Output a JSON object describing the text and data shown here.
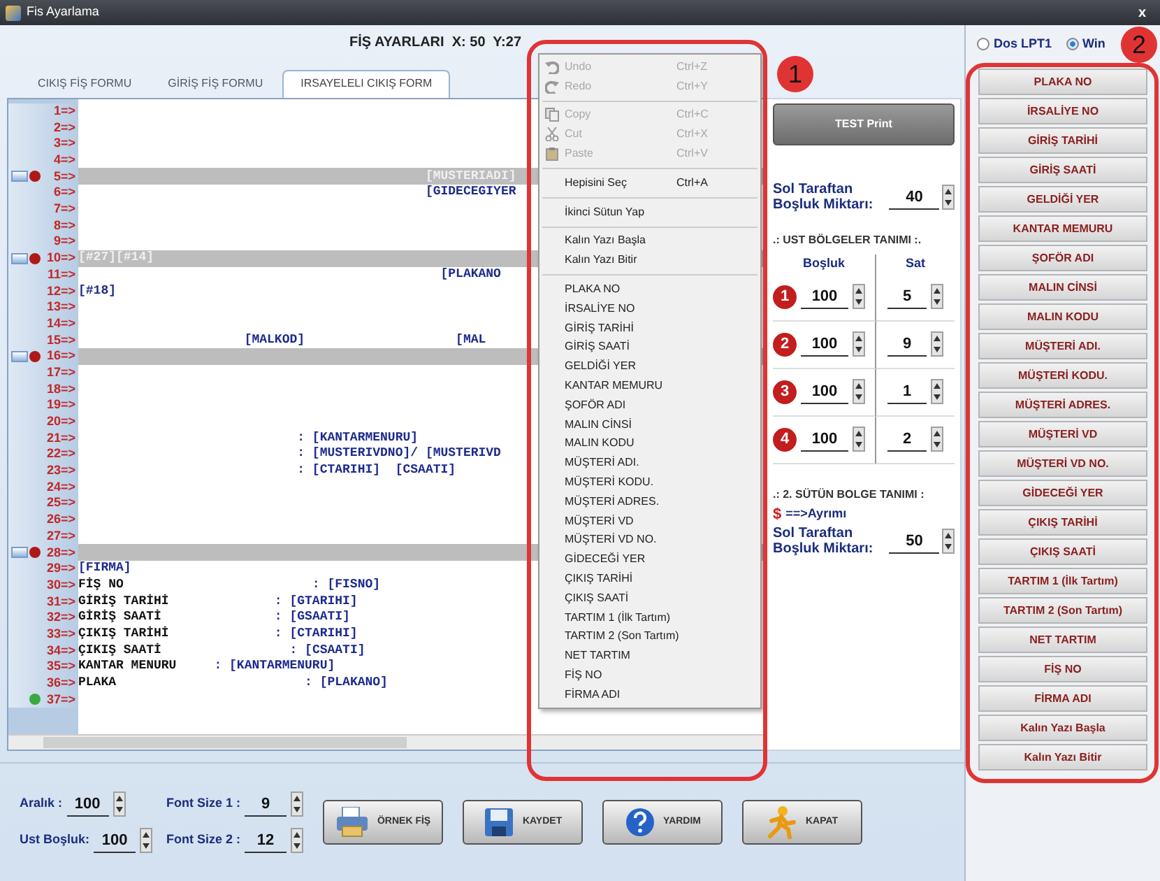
{
  "window": {
    "title": "Fis Ayarlama",
    "close": "x"
  },
  "header": "FİŞ AYARLARI  X: 50  Y:27",
  "tabs": [
    {
      "label": "CIKIŞ FİŞ FORMU",
      "selected": false
    },
    {
      "label": "GİRİŞ FİŞ FORMU",
      "selected": false
    },
    {
      "label": "IRSAYELELI CIKIŞ FORM",
      "selected": true
    }
  ],
  "editor": {
    "lines": [
      {
        "label": "1=>",
        "kind": "plain"
      },
      {
        "label": "2=>",
        "kind": "plain"
      },
      {
        "label": "3=>",
        "kind": "plain"
      },
      {
        "label": "4=>",
        "kind": "plain"
      },
      {
        "label": "5=>",
        "kind": "band",
        "segments": [
          {
            "kind": "field",
            "text": "                                              [MUSTERIADI]"
          }
        ]
      },
      {
        "label": "6=>",
        "kind": "plain",
        "segments": [
          {
            "kind": "field",
            "text": "                                              [GIDECEGIYER"
          }
        ]
      },
      {
        "label": "7=>",
        "kind": "plain"
      },
      {
        "label": "8=>",
        "kind": "plain"
      },
      {
        "label": "9=>",
        "kind": "plain"
      },
      {
        "label": "10=>",
        "kind": "band",
        "segments": [
          {
            "kind": "field",
            "text": "[#27][#14]"
          }
        ]
      },
      {
        "label": "11=>",
        "kind": "plain",
        "segments": [
          {
            "kind": "field",
            "text": "                                                [PLAKANO"
          }
        ]
      },
      {
        "label": "12=>",
        "kind": "plain",
        "segments": [
          {
            "kind": "field",
            "text": "[#18]"
          }
        ]
      },
      {
        "label": "13=>",
        "kind": "plain"
      },
      {
        "label": "14=>",
        "kind": "plain"
      },
      {
        "label": "15=>",
        "kind": "plain",
        "segments": [
          {
            "kind": "field",
            "text": "                      [MALKOD]                    [MAL"
          }
        ]
      },
      {
        "label": "16=>",
        "kind": "band"
      },
      {
        "label": "17=>",
        "kind": "plain"
      },
      {
        "label": "18=>",
        "kind": "plain"
      },
      {
        "label": "19=>",
        "kind": "plain"
      },
      {
        "label": "20=>",
        "kind": "plain"
      },
      {
        "label": "21=>",
        "kind": "plain",
        "segments": [
          {
            "kind": "field",
            "text": "                             : [KANTARMENURU]"
          }
        ]
      },
      {
        "label": "22=>",
        "kind": "plain",
        "segments": [
          {
            "kind": "field",
            "text": "                             : [MUSTERIVDNO]/ [MUSTERIVD"
          }
        ]
      },
      {
        "label": "23=>",
        "kind": "plain",
        "segments": [
          {
            "kind": "field",
            "text": "                             : [CTARIHI]  [CSAATI]"
          }
        ]
      },
      {
        "label": "24=>",
        "kind": "plain"
      },
      {
        "label": "25=>",
        "kind": "plain"
      },
      {
        "label": "26=>",
        "kind": "plain"
      },
      {
        "label": "27=>",
        "kind": "plain"
      },
      {
        "label": "28=>",
        "kind": "band"
      },
      {
        "label": "29=>",
        "kind": "plain",
        "segments": [
          {
            "kind": "field",
            "text": "[FIRMA]"
          }
        ]
      },
      {
        "label": "30=>",
        "kind": "plain",
        "segments": [
          {
            "kind": "label",
            "text": "FİŞ NO"
          },
          {
            "kind": "field",
            "text": "                         : [FISNO]"
          }
        ]
      },
      {
        "label": "31=>",
        "kind": "plain",
        "segments": [
          {
            "kind": "label",
            "text": "GİRİŞ TARİHİ"
          },
          {
            "kind": "field",
            "text": "              : [GTARIHI]"
          }
        ]
      },
      {
        "label": "32=>",
        "kind": "plain",
        "segments": [
          {
            "kind": "label",
            "text": "GİRİŞ SAATİ"
          },
          {
            "kind": "field",
            "text": "               : [GSAATI]"
          }
        ]
      },
      {
        "label": "33=>",
        "kind": "plain",
        "segments": [
          {
            "kind": "label",
            "text": "ÇIKIŞ TARİHİ"
          },
          {
            "kind": "field",
            "text": "              : [CTARIHI]"
          }
        ]
      },
      {
        "label": "34=>",
        "kind": "plain",
        "segments": [
          {
            "kind": "label",
            "text": "ÇIKIŞ SAATİ"
          },
          {
            "kind": "field",
            "text": "                 : [CSAATI]"
          }
        ]
      },
      {
        "label": "35=>",
        "kind": "plain",
        "segments": [
          {
            "kind": "label",
            "text": "KANTAR MENURU"
          },
          {
            "kind": "field",
            "text": "     : [KANTARMENURU]"
          }
        ]
      },
      {
        "label": "36=>",
        "kind": "plain",
        "segments": [
          {
            "kind": "label",
            "text": "PLAKA"
          },
          {
            "kind": "field",
            "text": "                         : [PLAKANO]"
          }
        ]
      },
      {
        "label": "37=>",
        "kind": "end"
      }
    ]
  },
  "context_menu": [
    {
      "kind": "item",
      "text": "Undo",
      "shortcut": "Ctrl+Z",
      "disabled": true
    },
    {
      "kind": "item",
      "text": "Redo",
      "shortcut": "Ctrl+Y",
      "disabled": true
    },
    {
      "kind": "separator"
    },
    {
      "kind": "item",
      "text": "Copy",
      "shortcut": "Ctrl+C",
      "disabled": true
    },
    {
      "kind": "item",
      "text": "Cut",
      "shortcut": "Ctrl+X",
      "disabled": true
    },
    {
      "kind": "item",
      "text": "Paste",
      "shortcut": "Ctrl+V",
      "disabled": true
    },
    {
      "kind": "separator"
    },
    {
      "kind": "item",
      "text": "Hepisini Seç",
      "shortcut": "Ctrl+A",
      "disabled": false
    },
    {
      "kind": "separator"
    },
    {
      "kind": "item",
      "text": "İkinci Sütun Yap",
      "disabled": false
    },
    {
      "kind": "separator"
    },
    {
      "kind": "item",
      "text": "Kalın Yazı Başla",
      "disabled": false
    },
    {
      "kind": "item",
      "text": "Kalın Yazı Bitir",
      "disabled": false
    },
    {
      "kind": "separator"
    },
    {
      "kind": "item",
      "text": "PLAKA NO",
      "disabled": false
    },
    {
      "kind": "item",
      "text": "İRSALİYE NO",
      "disabled": false
    },
    {
      "kind": "item",
      "text": "GİRİŞ TARİHİ",
      "disabled": false
    },
    {
      "kind": "item",
      "text": "GİRİŞ SAATİ",
      "disabled": false
    },
    {
      "kind": "item",
      "text": "GELDİĞİ YER",
      "disabled": false
    },
    {
      "kind": "item",
      "text": "KANTAR MEMURU",
      "disabled": false
    },
    {
      "kind": "item",
      "text": "ŞOFÖR ADI",
      "disabled": false
    },
    {
      "kind": "item",
      "text": "MALIN CİNSİ",
      "disabled": false
    },
    {
      "kind": "item",
      "text": "MALIN KODU",
      "disabled": false
    },
    {
      "kind": "item",
      "text": "MÜŞTERİ ADI.",
      "disabled": false
    },
    {
      "kind": "item",
      "text": "MÜŞTERİ KODU.",
      "disabled": false
    },
    {
      "kind": "item",
      "text": "MÜŞTERİ ADRES.",
      "disabled": false
    },
    {
      "kind": "item",
      "text": "MÜŞTERİ VD",
      "disabled": false
    },
    {
      "kind": "item",
      "text": "MÜŞTERİ VD NO.",
      "disabled": false
    },
    {
      "kind": "item",
      "text": "GİDECEĞİ YER",
      "disabled": false
    },
    {
      "kind": "item",
      "text": "ÇIKIŞ TARİHİ",
      "disabled": false
    },
    {
      "kind": "item",
      "text": "ÇIKIŞ SAATİ",
      "disabled": false
    },
    {
      "kind": "item",
      "text": "TARTIM 1 (İlk Tartım)",
      "disabled": false
    },
    {
      "kind": "item",
      "text": "TARTIM 2 (Son Tartım)",
      "disabled": false
    },
    {
      "kind": "item",
      "text": "NET TARTIM",
      "disabled": false
    },
    {
      "kind": "item",
      "text": "FİŞ NO",
      "disabled": false
    },
    {
      "kind": "item",
      "text": "FİRMA ADI",
      "disabled": false
    }
  ],
  "settings": {
    "test_button": "TEST Print",
    "left_margin": {
      "label": "Sol Taraftan Boşluk Miktarı:",
      "value": "40"
    },
    "upper_regions": {
      "title": ".: UST BÖLGELER TANIMI :.",
      "columns": [
        "Boşluk",
        "Sat"
      ],
      "rows": [
        {
          "number": "1",
          "spacing": "100",
          "line": "5"
        },
        {
          "number": "2",
          "spacing": "100",
          "line": "9"
        },
        {
          "number": "3",
          "spacing": "100",
          "line": "1"
        },
        {
          "number": "4",
          "spacing": "100",
          "line": "2"
        }
      ]
    },
    "second_column": {
      "title": ".: 2. SÜTÜN BOLGE TANIMI :",
      "separator_symbol": "$",
      "separator_label": "==>Ayrımı",
      "label": "Sol Taraftan Boşluk Miktarı:",
      "value": "50"
    }
  },
  "printer_options": [
    {
      "label": "Dos LPT1",
      "selected": false
    },
    {
      "label": "Win",
      "selected": true
    }
  ],
  "field_buttons": [
    "PLAKA NO",
    "İRSALİYE NO",
    "GİRİŞ TARİHİ",
    "GİRİŞ SAATİ",
    "GELDİĞİ YER",
    "KANTAR MEMURU",
    "ŞOFÖR ADI",
    "MALIN CİNSİ",
    "MALIN KODU",
    "MÜŞTERİ ADI.",
    "MÜŞTERİ KODU.",
    "MÜŞTERİ ADRES.",
    "MÜŞTERİ VD",
    "MÜŞTERİ VD NO.",
    "GİDECEĞİ YER",
    "ÇIKIŞ TARİHİ",
    "ÇIKIŞ SAATİ",
    "TARTIM 1 (İlk Tartım)",
    "TARTIM 2 (Son Tartım)",
    "NET TARTIM",
    "FİŞ NO",
    "FİRMA ADI",
    "Kalın Yazı Başla",
    "Kalın Yazı Bitir"
  ],
  "bottom": {
    "spin_fields": [
      {
        "label": "Aralık :",
        "value": "100"
      },
      {
        "label": "Font Size 1 :",
        "value": "9"
      },
      {
        "label": "Ust Boşluk:",
        "value": "100"
      },
      {
        "label": "Font Size 2 :",
        "value": "12"
      }
    ],
    "buttons": [
      {
        "kind": "sample",
        "label": "ÖRNEK FİŞ"
      },
      {
        "kind": "save",
        "label": "KAYDET"
      },
      {
        "kind": "help",
        "label": "YARDIM"
      },
      {
        "kind": "close",
        "label": "KAPAT"
      }
    ]
  },
  "annotations": [
    {
      "label": "1"
    },
    {
      "label": "2"
    }
  ]
}
